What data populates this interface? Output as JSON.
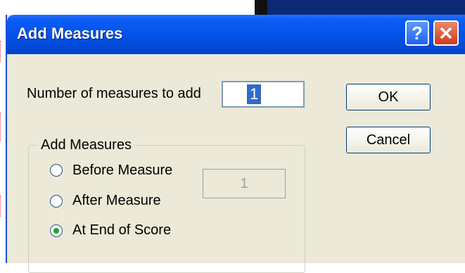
{
  "dialog": {
    "title": "Add Measures",
    "help_glyph": "?",
    "close_icon": "close-icon"
  },
  "number_field": {
    "label": "Number of measures to add",
    "value": "1"
  },
  "buttons": {
    "ok": "OK",
    "cancel": "Cancel"
  },
  "group": {
    "legend": "Add Measures",
    "options": [
      {
        "label": "Before Measure",
        "checked": false
      },
      {
        "label": "After Measure",
        "checked": false
      },
      {
        "label": "At End of Score",
        "checked": true
      }
    ],
    "measure_value": "1"
  },
  "colors": {
    "titlebar": "#0350e6",
    "dialog_bg": "#ece9d8",
    "selection": "#316ac5"
  }
}
